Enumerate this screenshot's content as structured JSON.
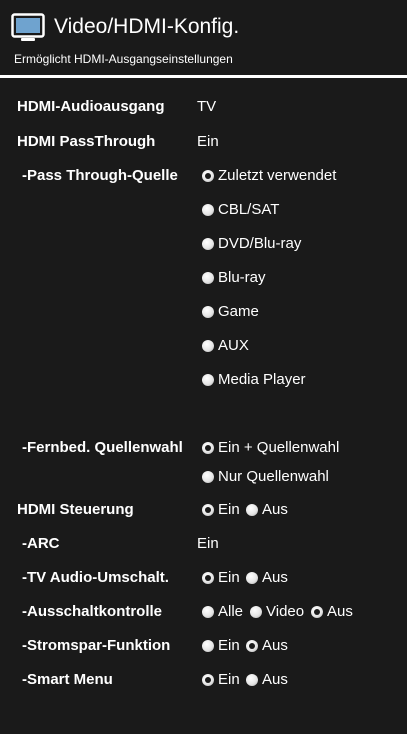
{
  "header": {
    "title": "Video/HDMI-Konfig.",
    "subtitle": "Ermöglicht HDMI-Ausgangseinstellungen",
    "icon": "tv-icon"
  },
  "settings": {
    "hdmi_audio_output": {
      "label": "HDMI-Audioausgang",
      "value": "TV"
    },
    "hdmi_passthrough": {
      "label": "HDMI PassThrough",
      "value": "Ein"
    },
    "passthrough_source": {
      "label": "-Pass Through-Quelle",
      "options": [
        "Zuletzt verwendet",
        "CBL/SAT",
        "DVD/Blu-ray",
        "Blu-ray",
        "Game",
        "AUX",
        "Media Player"
      ],
      "selected": "Zuletzt verwendet"
    },
    "remote_source_select": {
      "label": "-Fernbed. Quellenwahl",
      "options": [
        "Ein + Quellenwahl",
        "Nur Quellenwahl"
      ],
      "selected": "Ein + Quellenwahl"
    },
    "hdmi_control": {
      "label": "HDMI Steuerung",
      "options": [
        "Ein",
        "Aus"
      ],
      "selected": "Ein"
    },
    "arc": {
      "label": "-ARC",
      "value": "Ein"
    },
    "tv_audio_switch": {
      "label": "-TV Audio-Umschalt.",
      "options": [
        "Ein",
        "Aus"
      ],
      "selected": "Ein"
    },
    "power_off_control": {
      "label": "-Ausschaltkontrolle",
      "options": [
        "Alle",
        "Video",
        "Aus"
      ],
      "selected": "Aus"
    },
    "power_saving": {
      "label": "-Stromspar-Funktion",
      "options": [
        "Ein",
        "Aus"
      ],
      "selected": "Aus"
    },
    "smart_menu": {
      "label": "-Smart Menu",
      "options": [
        "Ein",
        "Aus"
      ],
      "selected": "Ein"
    }
  },
  "colors": {
    "background": "#1a1a1a",
    "text": "#ffffff"
  }
}
